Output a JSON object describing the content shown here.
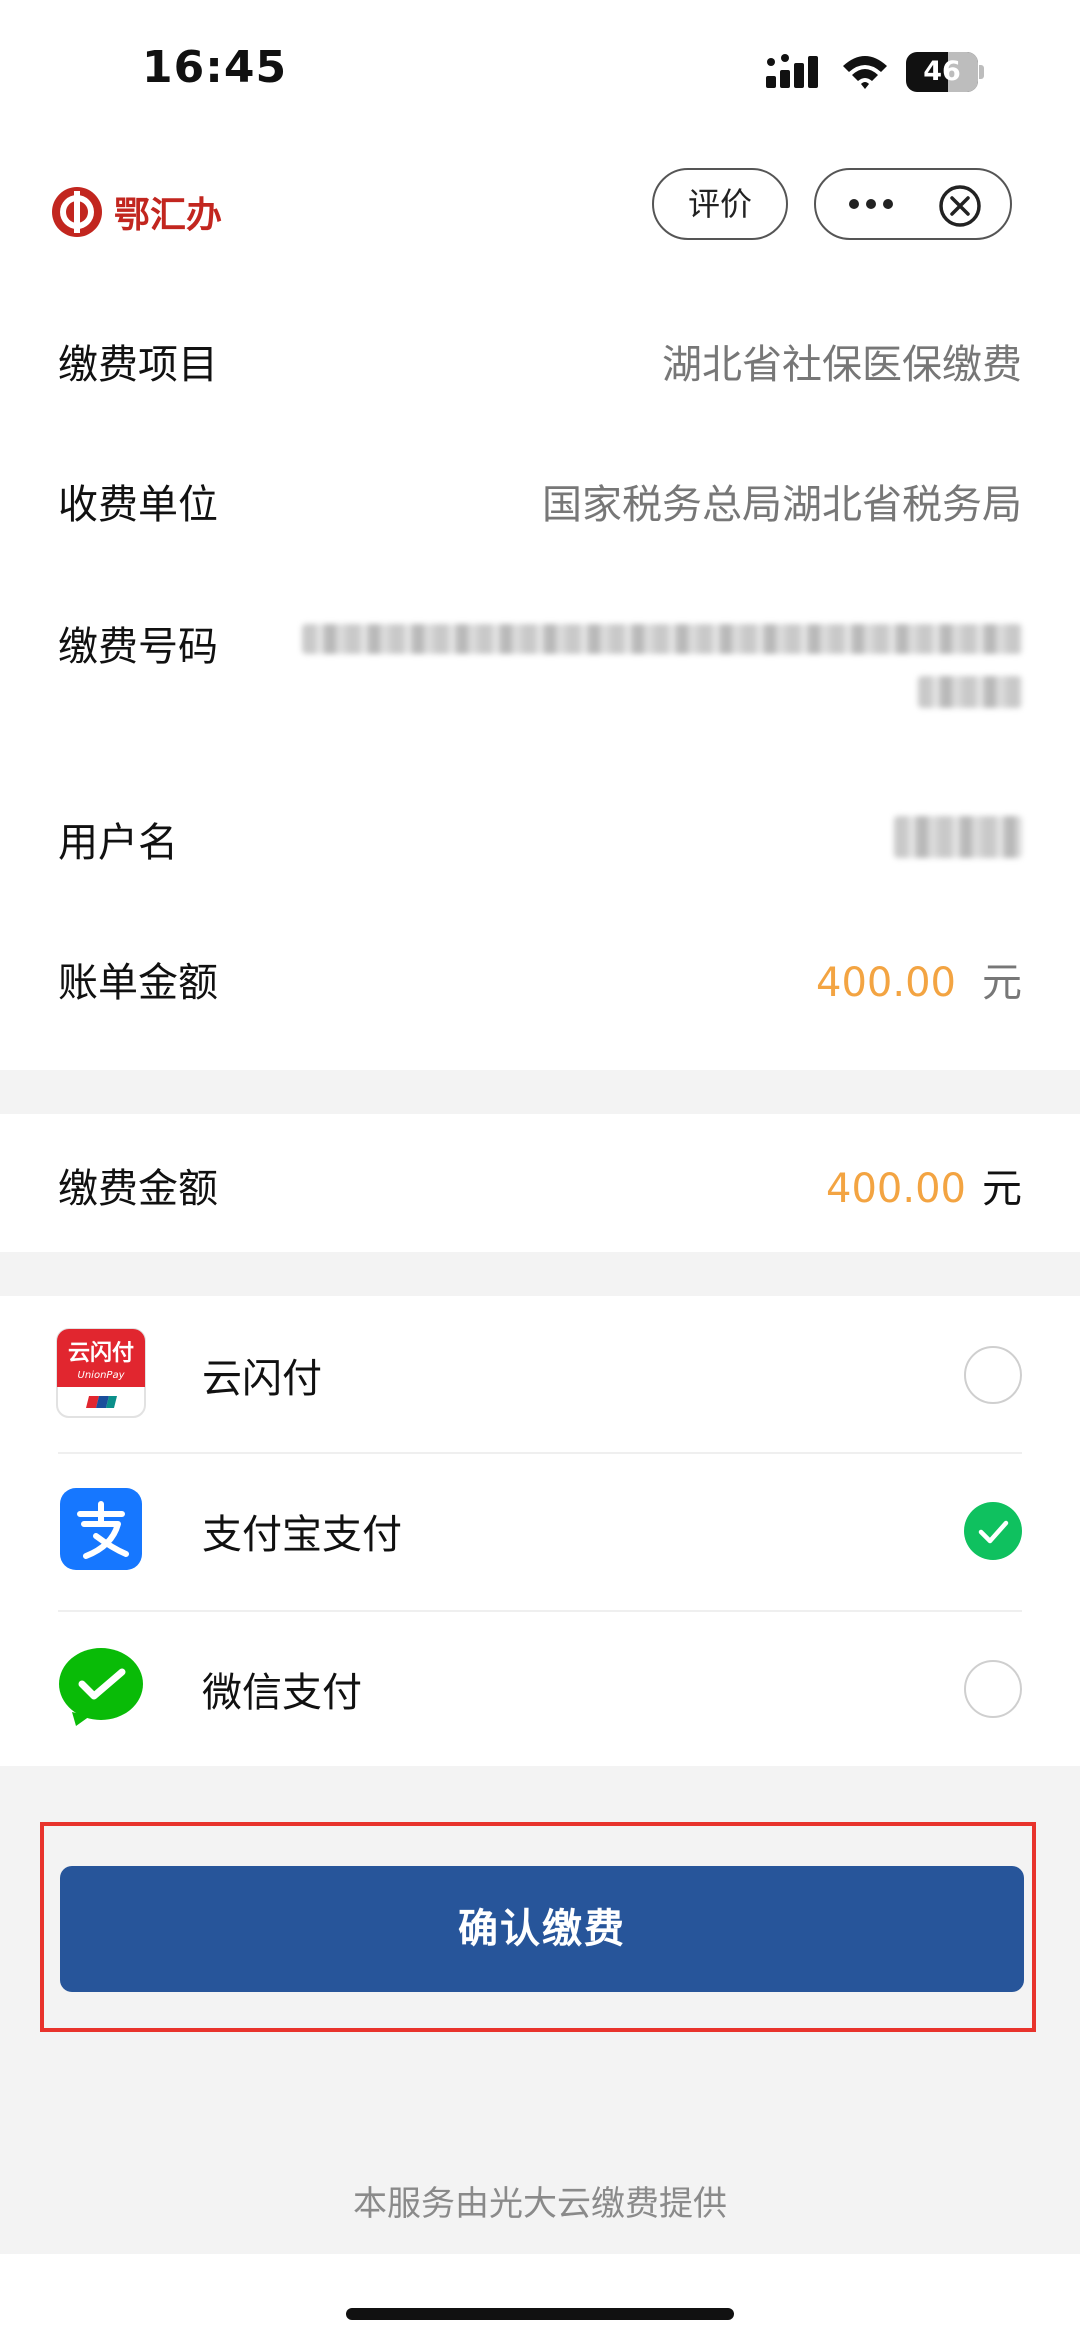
{
  "status_bar": {
    "time": "16:45",
    "battery": "46"
  },
  "nav": {
    "logo_text": "鄂汇办",
    "evaluate_label": "评价"
  },
  "bill": {
    "item_label": "缴费项目",
    "item_value": "湖北省社保医保缴费",
    "payee_label": "收费单位",
    "payee_value": "国家税务总局湖北省税务局",
    "number_label": "缴费号码",
    "username_label": "用户名",
    "amount_label": "账单金额",
    "amount_value": "400.00",
    "amount_unit": "元"
  },
  "payment": {
    "label": "缴费金额",
    "value": "400.00",
    "unit": "元"
  },
  "methods": [
    {
      "name": "云闪付",
      "selected": false
    },
    {
      "name": "支付宝支付",
      "selected": true
    },
    {
      "name": "微信支付",
      "selected": false
    }
  ],
  "unionpay_icon_text": "云闪付",
  "unionpay_icon_sub": "UnionPay",
  "confirm_label": "确认缴费",
  "footer": "本服务由光大云缴费提供",
  "colors": {
    "brand_red": "#c2261f",
    "amount_orange": "#f3a442",
    "confirm_blue": "#27559a",
    "check_green": "#0fc15f",
    "highlight_red": "#e8332c"
  }
}
